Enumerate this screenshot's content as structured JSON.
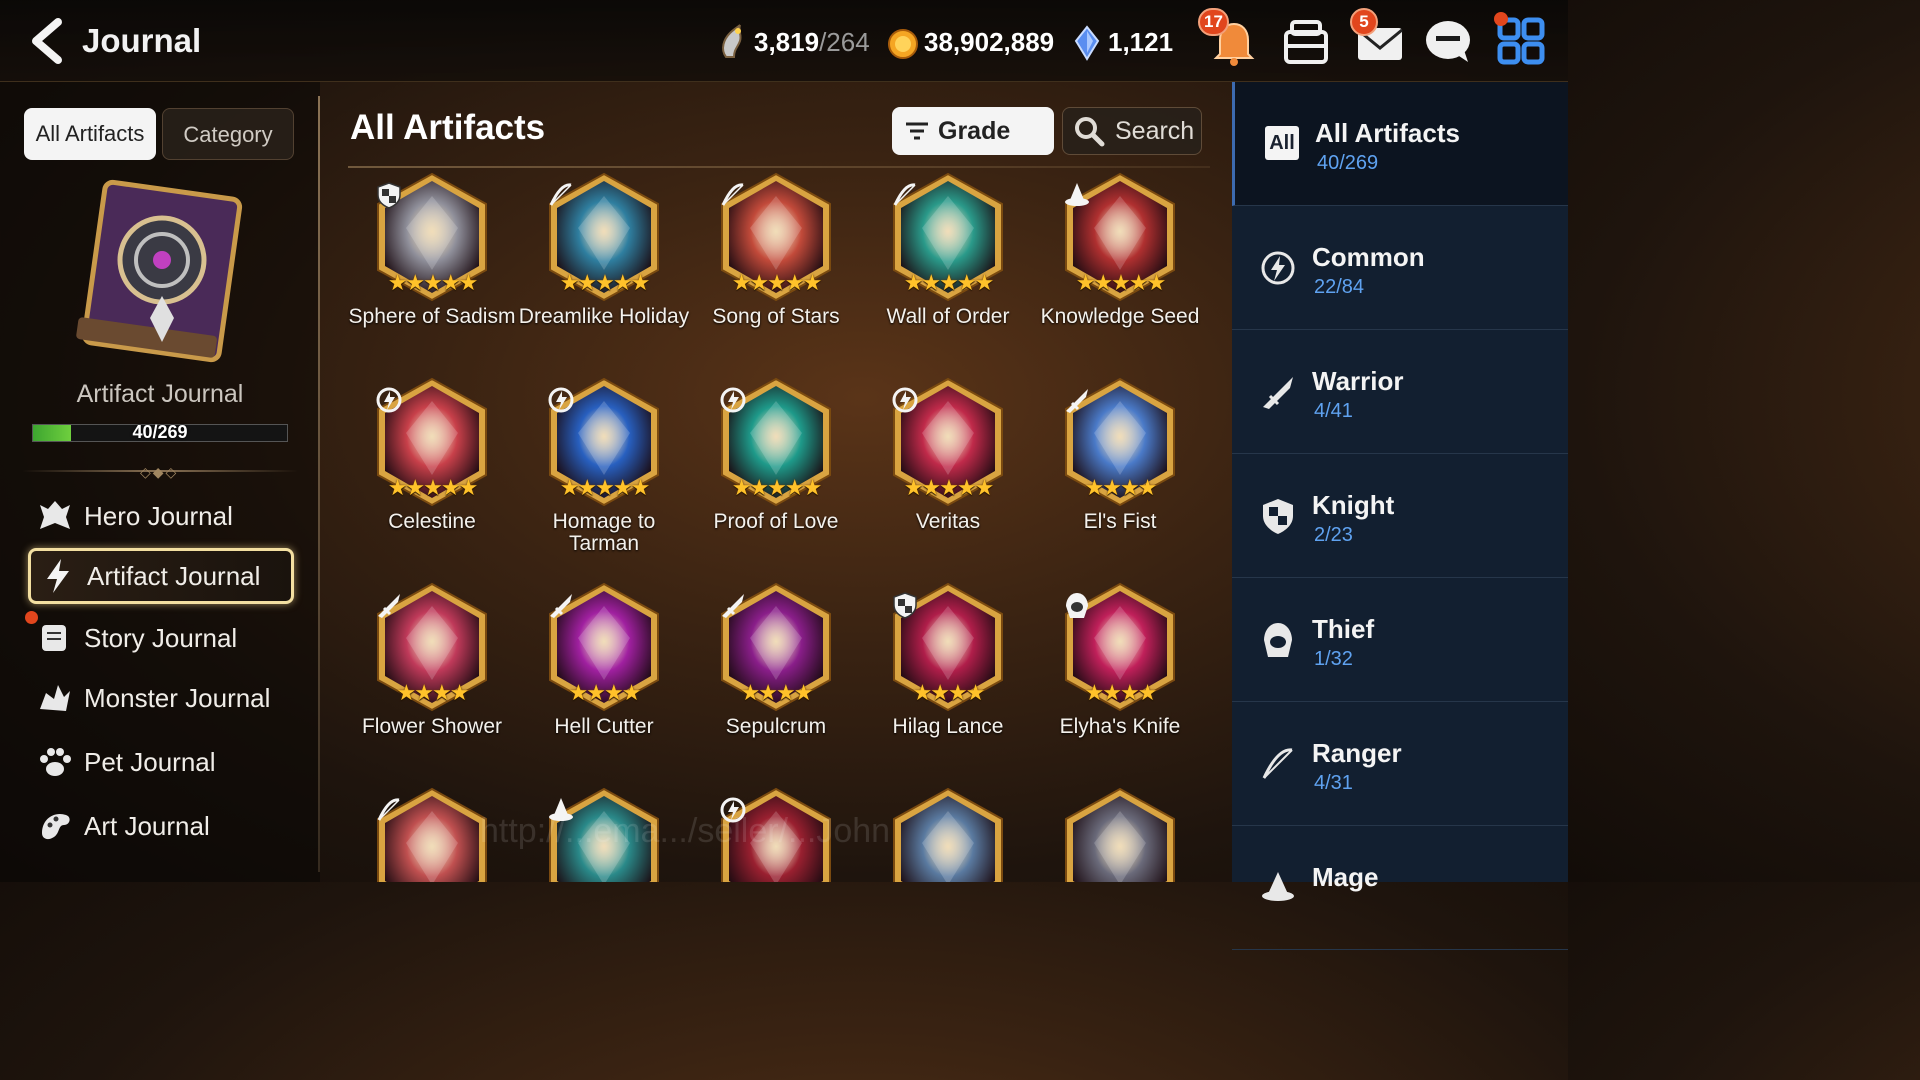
{
  "header": {
    "title": "Journal",
    "stamina": "3,819",
    "stamina_max": "/264",
    "gold": "38,902,889",
    "skystones": "1,121",
    "notifications_badge": "17",
    "mail_badge": "5"
  },
  "left_panel": {
    "tab_all": "All Artifacts",
    "tab_category": "Category",
    "journal_name": "Artifact Journal",
    "progress_text": "40/269",
    "progress_fraction": 0.149,
    "menu": [
      {
        "label": "Hero Journal",
        "icon": "hero-icon"
      },
      {
        "label": "Artifact Journal",
        "icon": "lightning-icon"
      },
      {
        "label": "Story Journal",
        "icon": "scroll-icon"
      },
      {
        "label": "Monster Journal",
        "icon": "monster-icon"
      },
      {
        "label": "Pet Journal",
        "icon": "paw-icon"
      },
      {
        "label": "Art Journal",
        "icon": "palette-icon"
      }
    ]
  },
  "main": {
    "title": "All Artifacts",
    "grade_label": "Grade",
    "search_label": "Search",
    "artifacts": [
      {
        "name": "Sphere of Sadism",
        "stars": 5,
        "class": "knight",
        "color": "#8f8f9a"
      },
      {
        "name": "Dreamlike Holiday",
        "stars": 5,
        "class": "ranger",
        "color": "#2f7fa0"
      },
      {
        "name": "Song of Stars",
        "stars": 5,
        "class": "ranger",
        "color": "#c24a3a"
      },
      {
        "name": "Wall of Order",
        "stars": 5,
        "class": "ranger",
        "color": "#2a9a8a"
      },
      {
        "name": "Knowledge Seed",
        "stars": 5,
        "class": "mage",
        "color": "#b03030"
      },
      {
        "name": "Celestine",
        "stars": 5,
        "class": "common",
        "color": "#c8404a"
      },
      {
        "name": "Homage to Tarman",
        "stars": 5,
        "class": "common",
        "color": "#2860c0"
      },
      {
        "name": "Proof of Love",
        "stars": 5,
        "class": "common",
        "color": "#1e9a8a"
      },
      {
        "name": "Veritas",
        "stars": 5,
        "class": "common",
        "color": "#c02a4a"
      },
      {
        "name": "El's Fist",
        "stars": 4,
        "class": "warrior",
        "color": "#4a7ac8"
      },
      {
        "name": "Flower Shower",
        "stars": 4,
        "class": "warrior",
        "color": "#c03a5a"
      },
      {
        "name": "Hell Cutter",
        "stars": 4,
        "class": "warrior",
        "color": "#a020a0"
      },
      {
        "name": "Sepulcrum",
        "stars": 4,
        "class": "warrior",
        "color": "#8a1e8a"
      },
      {
        "name": "Hilag Lance",
        "stars": 4,
        "class": "knight",
        "color": "#b01e4a"
      },
      {
        "name": "Elyha's Knife",
        "stars": 4,
        "class": "thief",
        "color": "#c0205a"
      },
      {
        "name": "",
        "stars": 0,
        "class": "ranger",
        "color": "#c05050"
      },
      {
        "name": "",
        "stars": 0,
        "class": "mage",
        "color": "#2a8a8a"
      },
      {
        "name": "",
        "stars": 0,
        "class": "common",
        "color": "#9a2030"
      },
      {
        "name": "",
        "stars": 0,
        "class": "",
        "color": "#5a7aa0"
      },
      {
        "name": "",
        "stars": 0,
        "class": "",
        "color": "#6a6a7a"
      }
    ]
  },
  "right_panel": {
    "categories": [
      {
        "name": "All Artifacts",
        "count": "40/269",
        "icon": "all-icon"
      },
      {
        "name": "Common",
        "count": "22/84",
        "icon": "common-icon"
      },
      {
        "name": "Warrior",
        "count": "4/41",
        "icon": "warrior-icon"
      },
      {
        "name": "Knight",
        "count": "2/23",
        "icon": "knight-icon"
      },
      {
        "name": "Thief",
        "count": "1/32",
        "icon": "thief-icon"
      },
      {
        "name": "Ranger",
        "count": "4/31",
        "icon": "ranger-icon"
      },
      {
        "name": "Mage",
        "count": "",
        "icon": "mage-icon"
      }
    ],
    "all_box": "All"
  }
}
